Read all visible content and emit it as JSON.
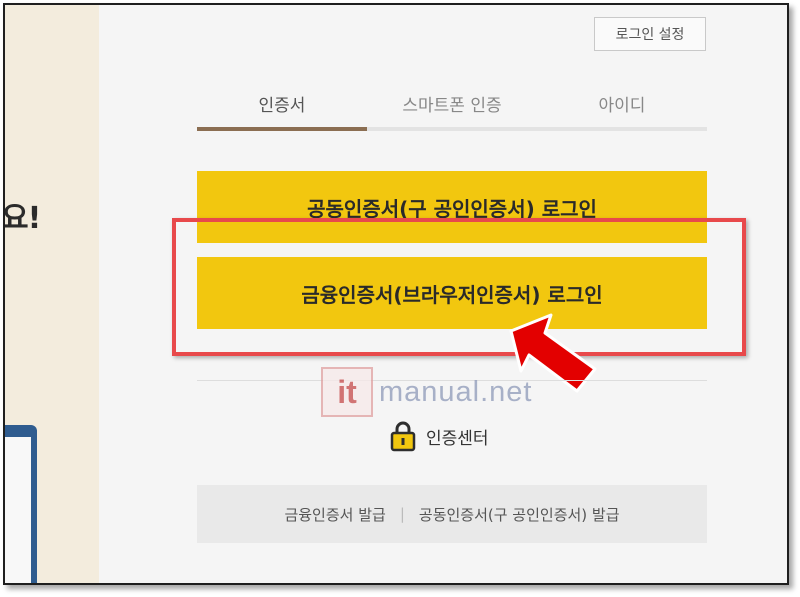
{
  "left_panel": {
    "partial_text": "요!"
  },
  "header": {
    "login_settings_label": "로그인 설정"
  },
  "tabs": [
    {
      "label": "인증서",
      "active": true
    },
    {
      "label": "스마트폰 인증",
      "active": false
    },
    {
      "label": "아이디",
      "active": false
    }
  ],
  "buttons": {
    "joint_cert_login": "공동인증서(구 공인인증서) 로그인",
    "financial_cert_login": "금융인증서(브라우저인증서) 로그인"
  },
  "watermark": {
    "logo_text": "it",
    "site_text": "manual.net"
  },
  "cert_center": {
    "label": "인증센터",
    "icon": "lock-icon"
  },
  "bottom_links": {
    "financial_issue": "금융인증서 발급",
    "separator": "|",
    "joint_issue": "공동인증서(구 공인인증서) 발급"
  },
  "colors": {
    "accent_yellow": "#f2c70f",
    "tab_active_bar": "#8b6e52",
    "highlight_red": "#e8494b",
    "arrow_red": "#e30000",
    "left_panel_bg": "#f3ecdd"
  }
}
